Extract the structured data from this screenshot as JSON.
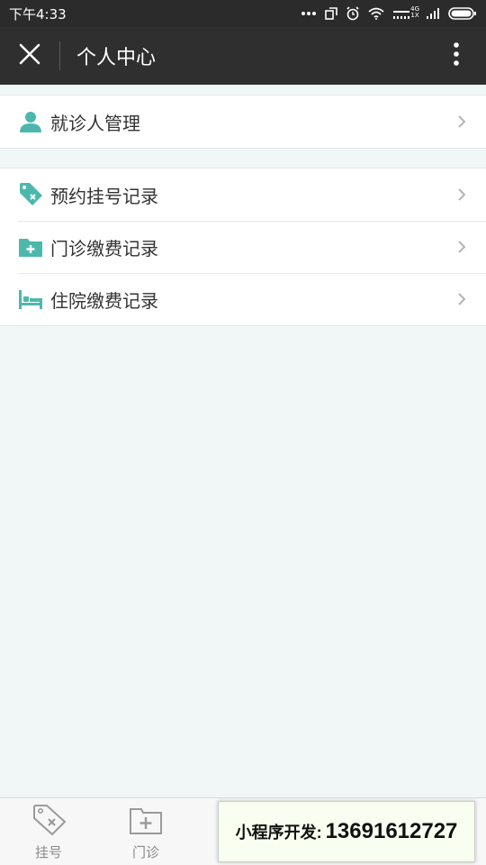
{
  "status_bar": {
    "time": "下午4:33",
    "icons": [
      "more-dots-icon",
      "screen-rotate-icon",
      "alarm-icon",
      "wifi-icon",
      "signal-4g-icon",
      "signal-icon",
      "battery-icon"
    ],
    "network_label_top": "4G",
    "network_label_bottom": "1X"
  },
  "nav": {
    "title": "个人中心",
    "close_icon": "close-icon",
    "more_icon": "more-vertical-icon"
  },
  "groups": [
    {
      "items": [
        {
          "label": "就诊人管理",
          "icon": "person-icon"
        }
      ]
    },
    {
      "items": [
        {
          "label": "预约挂号记录",
          "icon": "tag-x-icon"
        },
        {
          "label": "门诊缴费记录",
          "icon": "medical-kit-icon"
        },
        {
          "label": "住院缴费记录",
          "icon": "hospital-bed-icon"
        }
      ]
    }
  ],
  "tab_bar": {
    "tabs": [
      {
        "label": "挂号",
        "icon": "tag-x-icon"
      },
      {
        "label": "门诊",
        "icon": "medical-kit-icon"
      }
    ]
  },
  "watermark": {
    "label": "小程序开发:",
    "phone": "13691612727"
  },
  "colors": {
    "accent": "#4cb8ad",
    "nav_bg": "#2f2f2f",
    "status_bg": "#2b2b2b",
    "page_bg": "#f1f6f6"
  }
}
